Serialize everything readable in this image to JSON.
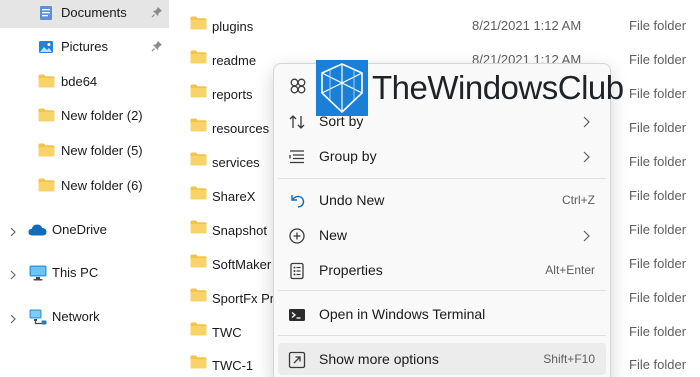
{
  "colors": {
    "folder": "#f3c34a",
    "folder_dark": "#e2a92f",
    "accent": "#0067c0",
    "watermark_blue": "#1a7fd6"
  },
  "nav": {
    "items": [
      {
        "label": "Documents",
        "icon": "documents-icon",
        "pinned": true,
        "selected": true
      },
      {
        "label": "Pictures",
        "icon": "pictures-icon",
        "pinned": true
      },
      {
        "label": "bde64",
        "icon": "folder-icon"
      },
      {
        "label": "New folder (2)",
        "icon": "folder-icon"
      },
      {
        "label": "New folder (5)",
        "icon": "folder-icon"
      },
      {
        "label": "New folder (6)",
        "icon": "folder-icon"
      },
      {
        "label": "OneDrive",
        "icon": "onedrive-icon",
        "expandable": true
      },
      {
        "label": "This PC",
        "icon": "this-pc-icon",
        "expandable": true
      },
      {
        "label": "Network",
        "icon": "network-icon",
        "expandable": true
      }
    ]
  },
  "files": [
    {
      "name": "plugins",
      "date": "8/21/2021 1:12 AM",
      "type": "File folder"
    },
    {
      "name": "readme",
      "date": "8/21/2021 1:12 AM",
      "type": "File folder"
    },
    {
      "name": "reports",
      "date": "",
      "type": "File folder"
    },
    {
      "name": "resources",
      "date": "",
      "type": "File folder"
    },
    {
      "name": "services",
      "date": "",
      "type": "File folder"
    },
    {
      "name": "ShareX",
      "date": "",
      "type": "File folder"
    },
    {
      "name": "Snapshot",
      "date": "",
      "type": "File folder"
    },
    {
      "name": "SoftMaker",
      "date": "",
      "type": "File folder"
    },
    {
      "name": "SportFx Pr",
      "date": "",
      "type": "File folder"
    },
    {
      "name": "TWC",
      "date": "",
      "type": "File folder"
    },
    {
      "name": "TWC-1",
      "date": "",
      "type": "File folder"
    }
  ],
  "context_menu": {
    "items": [
      {
        "label": "Sort by",
        "icon": "sort-icon",
        "submenu": true,
        "shortcut": ""
      },
      {
        "label": "Group by",
        "icon": "group-by-icon",
        "submenu": true,
        "shortcut": ""
      },
      {
        "label": "Undo New",
        "icon": "undo-icon",
        "submenu": false,
        "shortcut": "Ctrl+Z"
      },
      {
        "label": "New",
        "icon": "new-icon",
        "submenu": true,
        "shortcut": ""
      },
      {
        "label": "Properties",
        "icon": "properties-icon",
        "submenu": false,
        "shortcut": "Alt+Enter"
      },
      {
        "label": "Open in Windows Terminal",
        "icon": "terminal-icon",
        "submenu": false,
        "shortcut": ""
      },
      {
        "label": "Show more options",
        "icon": "show-more-options-icon",
        "submenu": false,
        "shortcut": "Shift+F10",
        "highlighted": true
      }
    ]
  },
  "watermark": {
    "text": "TheWindowsClub"
  }
}
